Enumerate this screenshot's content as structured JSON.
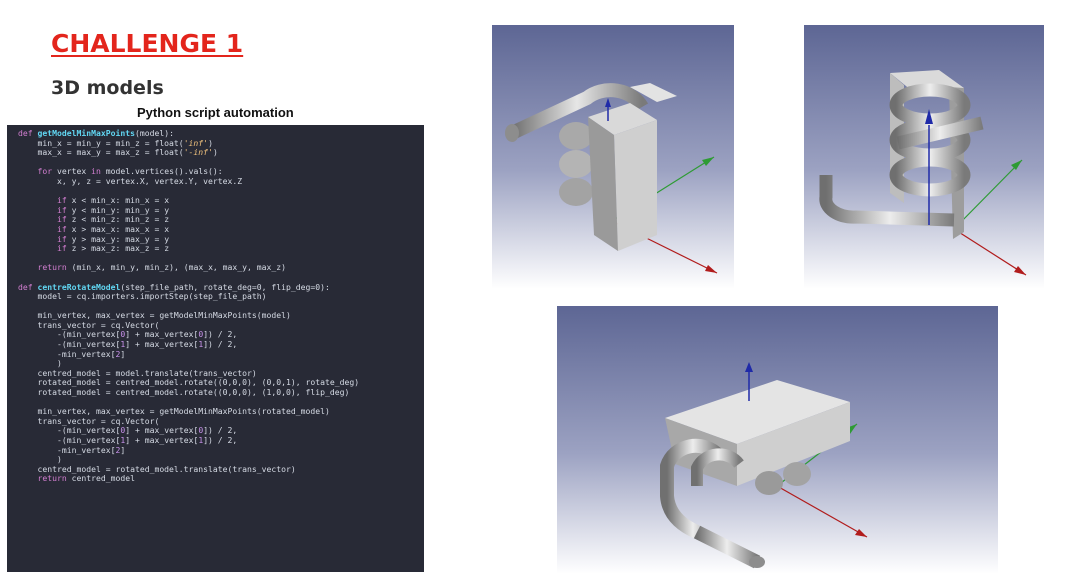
{
  "slide": {
    "title": "CHALLENGE 1",
    "subtitle": "3D models",
    "code_caption": "Python script automation"
  },
  "code": {
    "language": "python",
    "lines": [
      "def getModelMinMaxPoints(model):",
      "    min_x = min_y = min_z = float('inf')",
      "    max_x = max_y = max_z = float('-inf')",
      "",
      "    for vertex in model.vertices().vals():",
      "        x, y, z = vertex.X, vertex.Y, vertex.Z",
      "",
      "        if x < min_x: min_x = x",
      "        if y < min_y: min_y = y",
      "        if z < min_z: min_z = z",
      "        if x > max_x: max_x = x",
      "        if y > max_y: max_y = y",
      "        if z > max_z: max_z = z",
      "",
      "    return (min_x, min_y, min_z), (max_x, max_y, max_z)",
      "",
      "def centreRotateModel(step_file_path, rotate_deg=0, flip_deg=0):",
      "    model = cq.importers.importStep(step_file_path)",
      "",
      "    min_vertex, max_vertex = getModelMinMaxPoints(model)",
      "    trans_vector = cq.Vector(",
      "        -(min_vertex[0] + max_vertex[0]) / 2,",
      "        -(min_vertex[1] + max_vertex[1]) / 2,",
      "        -min_vertex[2]",
      "        )",
      "    centred_model = model.translate(trans_vector)",
      "    rotated_model = centred_model.rotate((0,0,0), (0,0,1), rotate_deg)",
      "    rotated_model = centred_model.rotate((0,0,0), (1,0,0), flip_deg)",
      "",
      "    min_vertex, max_vertex = getModelMinMaxPoints(rotated_model)",
      "    trans_vector = cq.Vector(",
      "        -(min_vertex[0] + max_vertex[0]) / 2,",
      "        -(min_vertex[1] + max_vertex[1]) / 2,",
      "        -min_vertex[2]",
      "        )",
      "    centred_model = rotated_model.translate(trans_vector)",
      "    return centred_model"
    ]
  },
  "views": [
    {
      "name": "model-view-1",
      "icon": "coil-component-3d-render"
    },
    {
      "name": "model-view-2",
      "icon": "coil-component-3d-render"
    },
    {
      "name": "model-view-3",
      "icon": "coil-component-3d-render"
    }
  ],
  "colors": {
    "title": "#e3251c",
    "code_bg": "#282a36",
    "keyword": "#d37fd1",
    "function": "#61d6f2",
    "string": "#f1c27d",
    "axis_x": "#b11c1c",
    "axis_y": "#2e9b34",
    "axis_z": "#1f2aa8",
    "viewport_top": "#5d6694",
    "viewport_bottom": "#ffffff"
  }
}
